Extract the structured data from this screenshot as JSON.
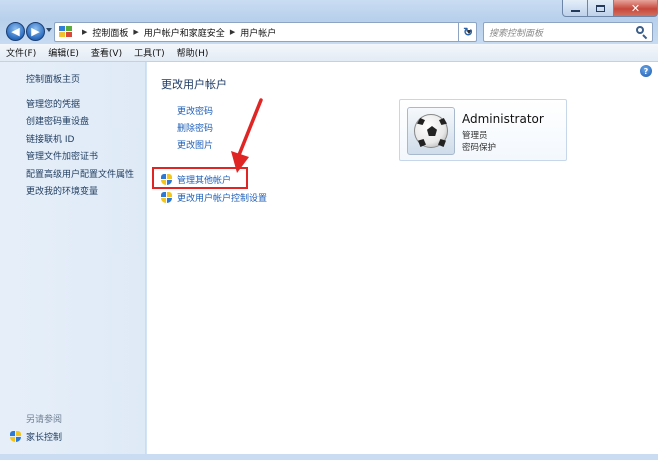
{
  "window": {
    "close_glyph": "✕"
  },
  "navigation": {
    "back_glyph": "◀",
    "forward_glyph": "▶",
    "breadcrumbs": [
      "控制面板",
      "用户帐户和家庭安全",
      "用户帐户"
    ],
    "refresh_glyph": "↻",
    "search_placeholder": "搜索控制面板"
  },
  "menubar": {
    "items": [
      "文件(F)",
      "编辑(E)",
      "查看(V)",
      "工具(T)",
      "帮助(H)"
    ]
  },
  "sidebar": {
    "home": "控制面板主页",
    "items": [
      "管理您的凭据",
      "创建密码重设盘",
      "链接联机 ID",
      "管理文件加密证书",
      "配置高级用户配置文件属性",
      "更改我的环境变量"
    ],
    "see_also": "另请参阅",
    "parental_controls": "家长控制"
  },
  "main": {
    "title": "更改用户帐户",
    "links": [
      "更改密码",
      "删除密码",
      "更改图片"
    ],
    "tasks": [
      "管理其他帐户",
      "更改用户帐户控制设置"
    ],
    "help_glyph": "?"
  },
  "account": {
    "name": "Administrator",
    "role": "管理员",
    "status": "密码保护"
  },
  "colors": {
    "link": "#1f5fb8",
    "highlight_border": "#e02525",
    "arrow": "#e02525",
    "title": "#1d3a64"
  }
}
